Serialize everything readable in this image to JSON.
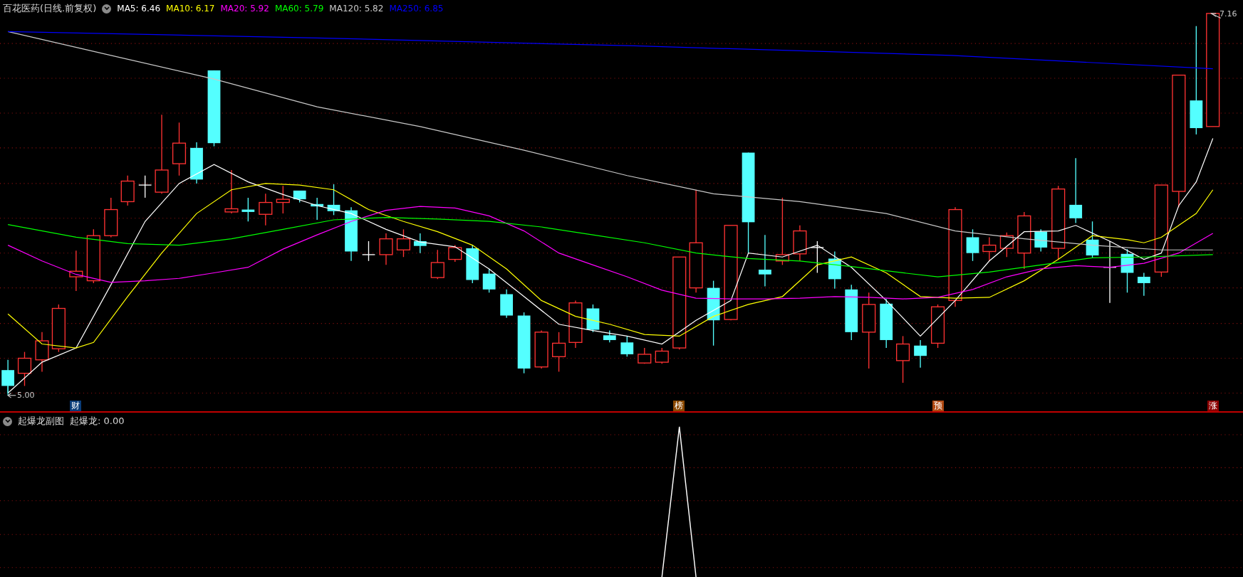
{
  "main_chart": {
    "title": "百花医药(日线.前复权)",
    "indicators": [
      {
        "label": "MA5: 6.46",
        "color": "#ffffff"
      },
      {
        "label": "MA10: 6.17",
        "color": "#ffff00"
      },
      {
        "label": "MA20: 5.92",
        "color": "#ff00ff"
      },
      {
        "label": "MA60: 5.79",
        "color": "#00ff00"
      },
      {
        "label": "MA120: 5.82",
        "color": "#c8c8c8"
      },
      {
        "label": "MA250: 6.85",
        "color": "#0000ff"
      }
    ],
    "high_label": "7.16",
    "low_label": "5.00",
    "markers": [
      {
        "text": "财",
        "color": "#0a3c78"
      },
      {
        "text": "榜",
        "color": "#8a4800"
      },
      {
        "text": "预",
        "color": "#b04810"
      },
      {
        "text": "涨",
        "color": "#8c0000"
      }
    ]
  },
  "sub_chart": {
    "title": "起爆龙副图",
    "indicator": "起爆龙: 0.00"
  }
}
